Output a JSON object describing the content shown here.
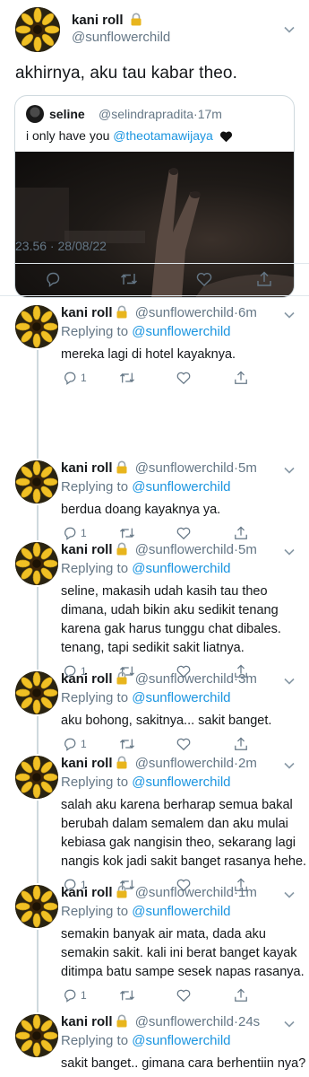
{
  "main_tweet": {
    "display_name": "kani roll",
    "handle": "@sunflowerchild",
    "text": "akhirnya, aku tau kabar theo.",
    "timestamp": "23.56 · 28/08/22",
    "quoted": {
      "display_name": "seline",
      "handle": "@selindrapradita",
      "time": "17m",
      "text": "i only have you",
      "mention": "@theotamawijaya"
    }
  },
  "replies": [
    {
      "display_name": "kani roll",
      "handle": "@sunflowerchild",
      "time": "6m",
      "replying_prefix": "Replying to",
      "replying_to": "@sunflowerchild",
      "lines": [
        "mereka lagi di hotel kayaknya."
      ],
      "reply_count": "1"
    },
    {
      "display_name": "kani roll",
      "handle": "@sunflowerchild",
      "time": "5m",
      "replying_prefix": "Replying to",
      "replying_to": "@sunflowerchild",
      "lines": [
        "berdua doang kayaknya ya."
      ],
      "reply_count": "1"
    },
    {
      "display_name": "kani roll",
      "handle": "@sunflowerchild",
      "time": "5m",
      "replying_prefix": "Replying to",
      "replying_to": "@sunflowerchild",
      "lines": [
        "seline, makasih udah kasih tau theo",
        "dimana, udah bikin aku sedikit tenang",
        "karena gak harus tunggu chat dibales.",
        "tenang, tapi sedikit sakit liatnya."
      ],
      "reply_count": "1"
    },
    {
      "display_name": "kani roll",
      "handle": "@sunflowerchild",
      "time": "3m",
      "replying_prefix": "Replying to",
      "replying_to": "@sunflowerchild",
      "lines": [
        "aku bohong, sakitnya... sakit banget."
      ],
      "reply_count": "1"
    },
    {
      "display_name": "kani roll",
      "handle": "@sunflowerchild",
      "time": "2m",
      "replying_prefix": "Replying to",
      "replying_to": "@sunflowerchild",
      "lines": [
        "salah aku karena berharap semua bakal",
        "berubah dalam semalem dan aku mulai",
        "kebiasa gak nangisin theo, sekarang lagi",
        "nangis kok jadi sakit banget rasanya hehe."
      ],
      "reply_count": "1"
    },
    {
      "display_name": "kani roll",
      "handle": "@sunflowerchild",
      "time": "1m",
      "replying_prefix": "Replying to",
      "replying_to": "@sunflowerchild",
      "lines": [
        "semakin banyak air mata, dada aku",
        "semakin sakit. kali ini berat banget kayak",
        "ditimpa batu sampe sesek napas rasanya."
      ],
      "reply_count": "1"
    },
    {
      "display_name": "kani roll",
      "handle": "@sunflowerchild",
      "time": "24s",
      "replying_prefix": "Replying to",
      "replying_to": "@sunflowerchild",
      "lines": [
        "sakit banget.. gimana cara berhentiin nya?"
      ],
      "reply_count": ""
    }
  ],
  "colors": {
    "link": "#1b95e0",
    "secondary_text": "#657786",
    "divider": "#e1e8ed",
    "lock": "#e8b51d"
  },
  "icons": [
    "lock-icon",
    "chevron-down-icon",
    "reply-icon",
    "retweet-icon",
    "like-icon",
    "share-icon",
    "black-heart-icon",
    "sunflower-avatar"
  ]
}
